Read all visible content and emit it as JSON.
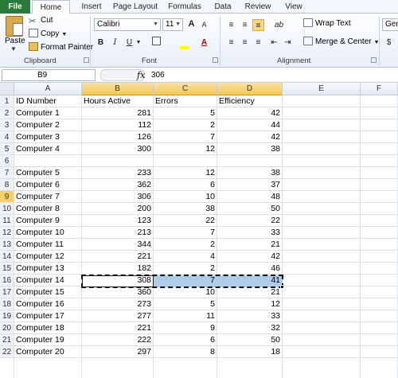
{
  "tabs": [
    "File",
    "Home",
    "Insert",
    "Page Layout",
    "Formulas",
    "Data",
    "Review",
    "View"
  ],
  "clipboard": {
    "paste_label": "Paste",
    "cut_label": "Cut",
    "copy_label": "Copy",
    "format_painter_label": "Format Painter",
    "group_label": "Clipboard"
  },
  "font": {
    "font_name": "Calibri",
    "font_size": "11",
    "bold": "B",
    "italic": "I",
    "underline": "U",
    "grow": "A",
    "shrink": "A",
    "font_color_glyph": "A",
    "group_label": "Font"
  },
  "alignment": {
    "wrap_text_label": "Wrap Text",
    "merge_label": "Merge & Center",
    "group_label": "Alignment"
  },
  "number": {
    "format_value": "Gene",
    "currency_glyph": "$"
  },
  "formula_bar": {
    "name_box": "B9",
    "fx": "fx",
    "value": "306"
  },
  "columns": [
    "A",
    "B",
    "C",
    "D",
    "E",
    "F"
  ],
  "rows": [
    {
      "n": "1",
      "a": "ID Number",
      "b": "Hours Active",
      "c": "Errors",
      "d": "Efficiency"
    },
    {
      "n": "2",
      "a": "Computer 1",
      "b": "281",
      "c": "5",
      "d": "42"
    },
    {
      "n": "3",
      "a": "Computer 2",
      "b": "112",
      "c": "2",
      "d": "44"
    },
    {
      "n": "4",
      "a": "Computer 3",
      "b": "126",
      "c": "7",
      "d": "42"
    },
    {
      "n": "5",
      "a": "Computer 4",
      "b": "300",
      "c": "12",
      "d": "38"
    },
    {
      "n": "6",
      "a": "",
      "b": "",
      "c": "",
      "d": ""
    },
    {
      "n": "7",
      "a": "Computer 5",
      "b": "233",
      "c": "12",
      "d": "38"
    },
    {
      "n": "8",
      "a": "Computer 6",
      "b": "362",
      "c": "6",
      "d": "37"
    },
    {
      "n": "9",
      "a": "Computer 7",
      "b": "306",
      "c": "10",
      "d": "48"
    },
    {
      "n": "10",
      "a": "Computer 8",
      "b": "200",
      "c": "38",
      "d": "50"
    },
    {
      "n": "11",
      "a": "Computer 9",
      "b": "123",
      "c": "22",
      "d": "22"
    },
    {
      "n": "12",
      "a": "Computer 10",
      "b": "213",
      "c": "7",
      "d": "33"
    },
    {
      "n": "13",
      "a": "Computer 11",
      "b": "344",
      "c": "2",
      "d": "21"
    },
    {
      "n": "14",
      "a": "Computer 12",
      "b": "221",
      "c": "4",
      "d": "42"
    },
    {
      "n": "15",
      "a": "Computer 13",
      "b": "182",
      "c": "2",
      "d": "46"
    },
    {
      "n": "16",
      "a": "Computer 14",
      "b": "308",
      "c": "7",
      "d": "41"
    },
    {
      "n": "17",
      "a": "Computer 15",
      "b": "360",
      "c": "10",
      "d": "21"
    },
    {
      "n": "18",
      "a": "Computer 16",
      "b": "273",
      "c": "5",
      "d": "12"
    },
    {
      "n": "19",
      "a": "Computer 17",
      "b": "277",
      "c": "11",
      "d": "33"
    },
    {
      "n": "20",
      "a": "Computer 18",
      "b": "221",
      "c": "9",
      "d": "32"
    },
    {
      "n": "21",
      "a": "Computer 19",
      "b": "222",
      "c": "6",
      "d": "50"
    },
    {
      "n": "22",
      "a": "Computer 20",
      "b": "297",
      "c": "8",
      "d": "18"
    }
  ],
  "colors": {
    "selection_fill": "#aecbe8",
    "header_highlight": "#f3c755",
    "file_tab": "#2a7a3a"
  }
}
